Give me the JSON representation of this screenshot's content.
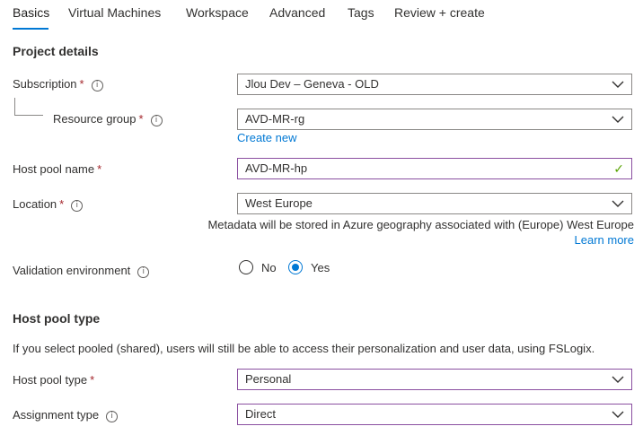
{
  "tabs": [
    {
      "label": "Basics"
    },
    {
      "label": "Virtual Machines"
    },
    {
      "label": "Workspace"
    },
    {
      "label": "Advanced"
    },
    {
      "label": "Tags"
    },
    {
      "label": "Review + create"
    }
  ],
  "project_details": {
    "title": "Project details",
    "subscription": {
      "label": "Subscription",
      "required": "*",
      "value": "Jlou Dev – Geneva - OLD"
    },
    "resource_group": {
      "label": "Resource group",
      "required": "*",
      "value": "AVD-MR-rg",
      "create_new": "Create new"
    },
    "host_pool_name": {
      "label": "Host pool name",
      "required": "*",
      "value": "AVD-MR-hp"
    },
    "location": {
      "label": "Location",
      "required": "*",
      "value": "West Europe",
      "metadata_note": "Metadata will be stored in Azure geography associated with (Europe) West Europe",
      "learn_more": "Learn more"
    },
    "validation": {
      "label": "Validation environment",
      "options": [
        {
          "label": "No",
          "checked": false
        },
        {
          "label": "Yes",
          "checked": true
        }
      ]
    }
  },
  "host_pool_type_section": {
    "title": "Host pool type",
    "description": "If you select pooled (shared), users will still be able to access their personalization and user data, using FSLogix.",
    "host_pool_type": {
      "label": "Host pool type",
      "required": "*",
      "value": "Personal"
    },
    "assignment_type": {
      "label": "Assignment type",
      "value": "Direct"
    }
  },
  "icons": {
    "info": "info-icon",
    "chevron": "chevron-down-icon",
    "check": "checkmark-icon"
  },
  "colors": {
    "accent": "#0078d4",
    "required": "#a4262c",
    "focus_border": "#8a4fa0",
    "valid": "#57a300"
  }
}
